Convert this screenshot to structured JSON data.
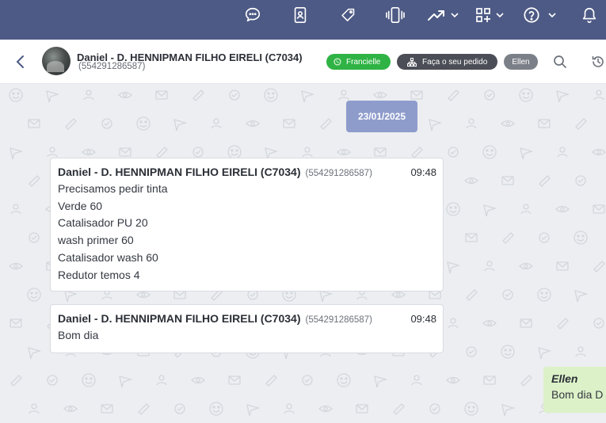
{
  "topbar": {
    "icons": [
      "chat-bubbles-icon",
      "contact-card-icon",
      "tag-icon",
      "vibrate-phone-icon",
      "trending-up-icon",
      "apps-grid-add-icon",
      "help-circle-icon",
      "bell-icon"
    ]
  },
  "header": {
    "contact_name": "Daniel - D. HENNIPMAN FILHO EIRELI (C7034)",
    "contact_phone": "(554291286587)",
    "chips": {
      "whatsapp_agent": "Francielle",
      "order": "Faça o seu pedido",
      "assignee": "Ellen"
    },
    "chip_colors": {
      "green": "#2fb344",
      "dark": "#4b4e56",
      "gray": "#7b7f87"
    },
    "topbar_color": "#4d5a85"
  },
  "chat": {
    "date_badge": "23/01/2025",
    "messages": [
      {
        "sender": "Daniel - D. HENNIPMAN FILHO EIRELI (C7034)",
        "phone": "(554291286587)",
        "time": "09:48",
        "lines": [
          "Precisamos pedir tinta",
          "Verde 60",
          "Catalisador PU 20",
          "wash primer 60",
          "Catalisador wash 60",
          "Redutor temos 4"
        ]
      },
      {
        "sender": "Daniel - D. HENNIPMAN FILHO EIRELI (C7034)",
        "phone": "(554291286587)",
        "time": "09:48",
        "lines": [
          "Bom dia"
        ]
      }
    ],
    "outgoing": {
      "sender": "Ellen",
      "text": "Bom dia D"
    }
  }
}
